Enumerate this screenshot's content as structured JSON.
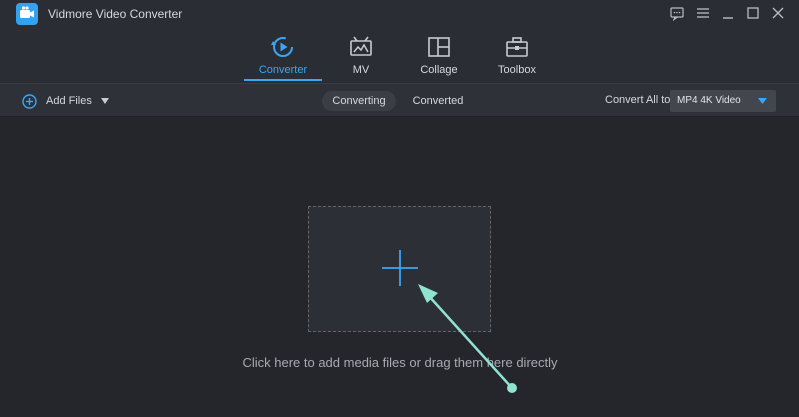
{
  "window": {
    "title": "Vidmore Video Converter",
    "logo_icon": "video-camera-icon",
    "controls": [
      "feedback-icon",
      "menu-icon",
      "minimize-icon",
      "maximize-icon",
      "close-icon"
    ]
  },
  "nav": {
    "tabs": [
      {
        "label": "Converter",
        "icon": "converter-icon",
        "active": true
      },
      {
        "label": "MV",
        "icon": "mv-icon",
        "active": false
      },
      {
        "label": "Collage",
        "icon": "collage-icon",
        "active": false
      },
      {
        "label": "Toolbox",
        "icon": "toolbox-icon",
        "active": false
      }
    ]
  },
  "toolbar": {
    "add_files_label": "Add Files",
    "segments": [
      {
        "label": "Converting",
        "active": true
      },
      {
        "label": "Converted",
        "active": false
      }
    ],
    "convert_all_label": "Convert All to:",
    "format_value": "MP4 4K Video"
  },
  "dropzone": {
    "icon": "plus-icon",
    "hint": "Click here to add media files or drag them here directly"
  },
  "colors": {
    "accent": "#37a7f6",
    "background": "#25262c",
    "annotation_arrow": "#8fe3d0"
  }
}
